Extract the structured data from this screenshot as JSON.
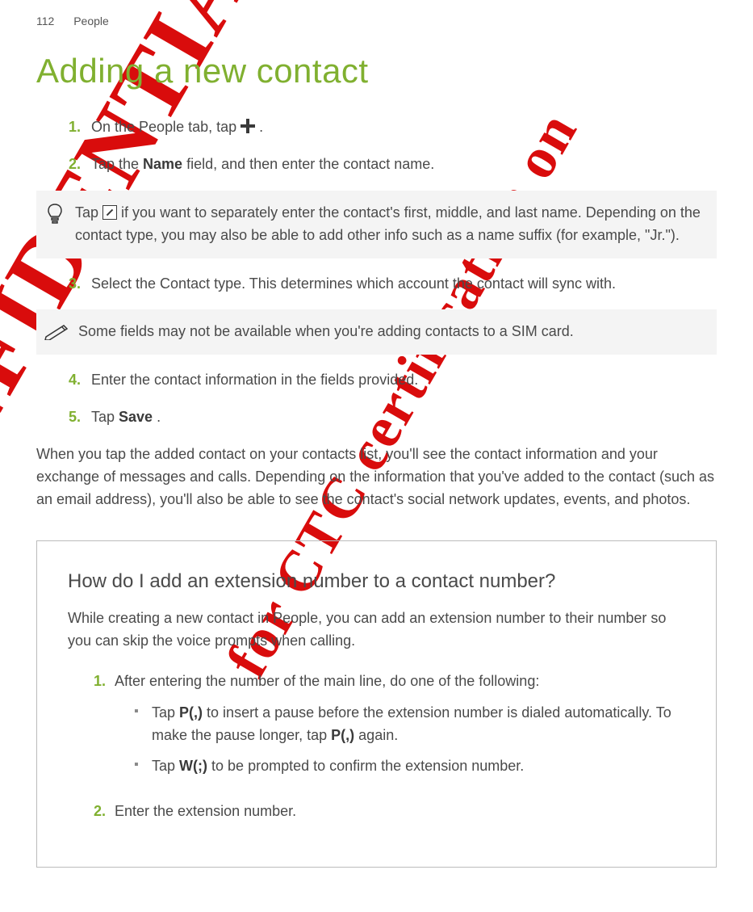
{
  "header": {
    "page_number": "112",
    "section": "People"
  },
  "title": "Adding a new contact",
  "steps": [
    {
      "num": "1.",
      "text_before": "On the People tab, tap ",
      "icon": "plus-icon",
      "text_after": " ."
    },
    {
      "num": "2.",
      "text_before": "Tap the ",
      "bold_1": "Name",
      "text_mid": " field, and then enter the contact name."
    }
  ],
  "tip_callout": {
    "text_before": "Tap ",
    "text_after": " if you want to separately enter the contact's first, middle, and last name. Depending on the contact type, you may also be able to add other info such as a name suffix (for example, \"Jr.\")."
  },
  "steps2": [
    {
      "num": "3.",
      "text": "Select the Contact type. This determines which account the contact will sync with."
    }
  ],
  "note_callout": "Some fields may not be available when you're adding contacts to a SIM card.",
  "steps3": [
    {
      "num": "4.",
      "text": "Enter the contact information in the fields provided."
    },
    {
      "num": "5.",
      "text_before": "Tap ",
      "bold_1": "Save",
      "text_after": "."
    }
  ],
  "para_after": "When you tap the added contact on your contacts list, you'll see the contact information and your exchange of messages and calls. Depending on the information that you've added to the contact (such as an email address), you'll also be able to see the contact's social network updates, events, and photos.",
  "box": {
    "heading": "How do I add an extension number to a contact number?",
    "para": "While creating a new contact in People, you can add an extension number to their number so you can skip the voice prompts when calling.",
    "steps": [
      {
        "num": "1.",
        "text": "After entering the number of the main line, do one of the following:",
        "bullets": [
          {
            "text_before": "Tap ",
            "bold_1": "P(,)",
            "text_mid": " to insert a pause before the extension number is dialed automatically. To make the pause longer, tap ",
            "bold_2": "P(,)",
            "text_after": " again."
          },
          {
            "text_before": "Tap ",
            "bold_1": "W(;)",
            "text_after": " to be prompted to confirm the extension number."
          }
        ]
      },
      {
        "num": "2.",
        "text": "Enter the extension number."
      }
    ]
  },
  "watermarks": {
    "wm1": "CONFIDENTIAL",
    "wm2": "for CTC certification on"
  }
}
